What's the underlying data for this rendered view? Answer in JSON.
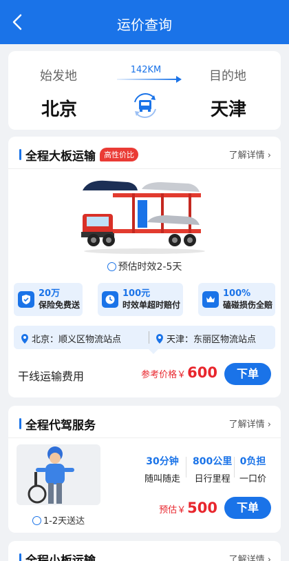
{
  "header": {
    "title": "运价查询",
    "back_icon": "chevron-left-icon"
  },
  "route": {
    "origin_label": "始发地",
    "origin_city": "北京",
    "dest_label": "目的地",
    "dest_city": "天津",
    "distance": "142KM"
  },
  "big_truck": {
    "title": "全程大板运输",
    "badge": "高性价比",
    "more": "了解详情",
    "eta": "预估时效2-5天",
    "features": [
      {
        "value": "20万",
        "desc": "保险免费送",
        "icon": "shield-check-icon"
      },
      {
        "value": "100元",
        "desc": "时效单超时赔付",
        "icon": "clock-icon"
      },
      {
        "value": "100%",
        "desc": "磕碰损伤全赔",
        "icon": "crown-icon"
      }
    ],
    "origin_station": "北京：顺义区物流站点",
    "dest_station": "天津：东丽区物流站点",
    "fee_label": "干线运输费用",
    "price_label": "参考价格￥",
    "price": "600",
    "order_label": "下单"
  },
  "driver": {
    "title": "全程代驾服务",
    "more": "了解详情",
    "eta": "1-2天送达",
    "stats": [
      {
        "value": "30分钟",
        "desc": "随叫随走"
      },
      {
        "value": "800公里",
        "desc": "日行里程"
      },
      {
        "value": "0负担",
        "desc": "一口价"
      }
    ],
    "price_label": "预估￥",
    "price": "500",
    "order_label": "下单"
  },
  "small_truck": {
    "title": "全程小板运输",
    "more": "了解详情"
  },
  "colors": {
    "primary": "#1a73e8",
    "price": "#e8262d",
    "badge": "#ea3b35"
  }
}
